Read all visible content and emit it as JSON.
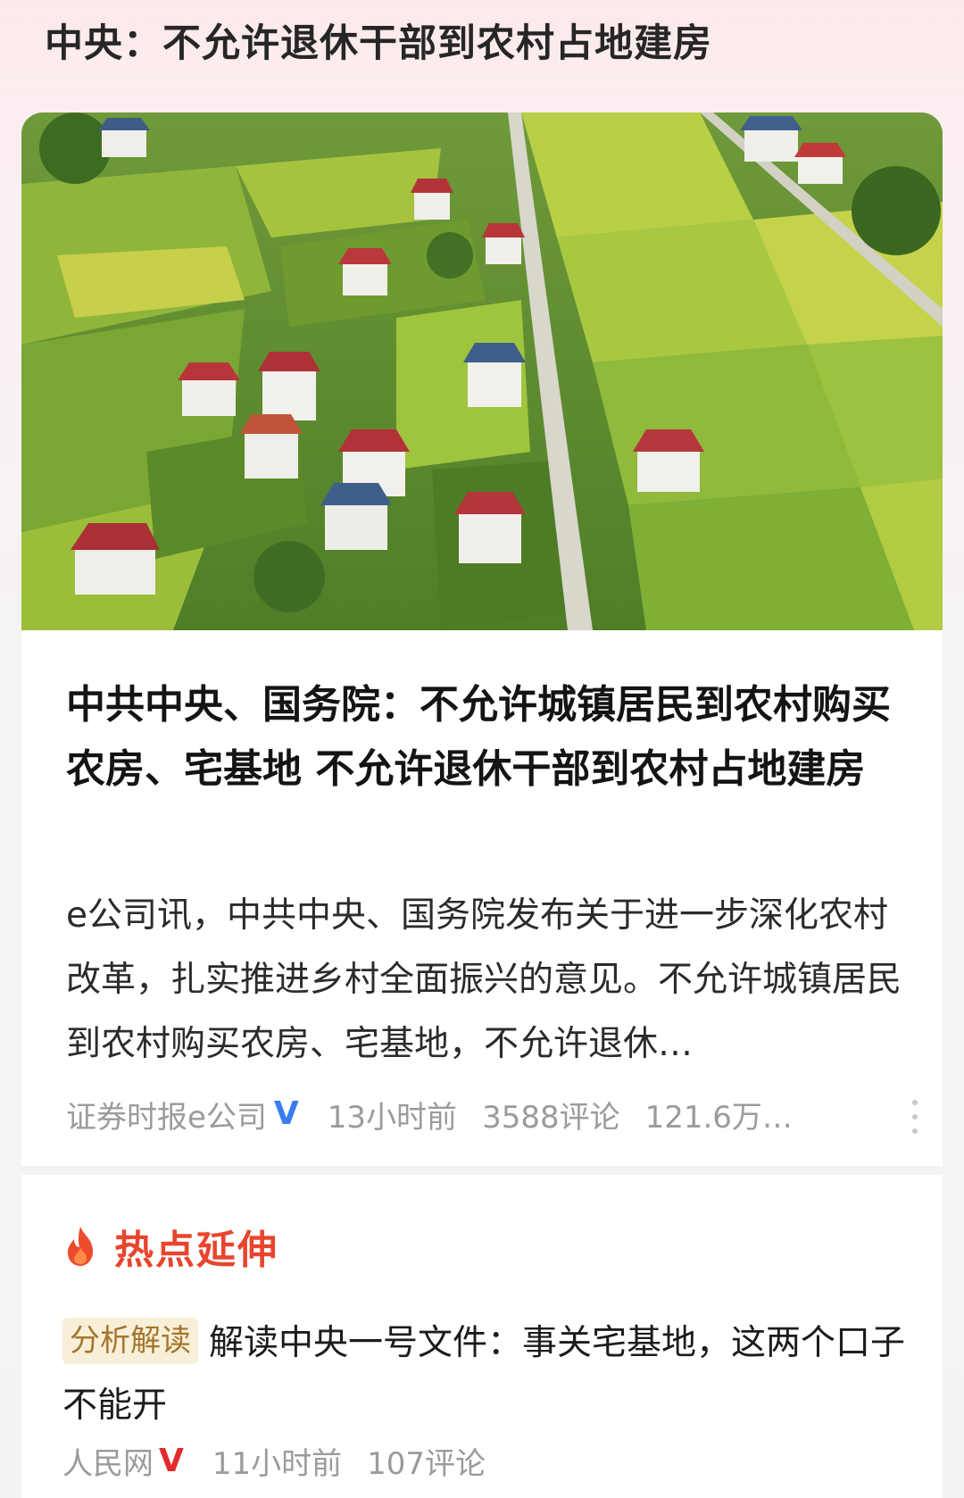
{
  "page": {
    "top_title": "中央：不允许退休干部到农村占地建房"
  },
  "article": {
    "headline": "中共中央、国务院：不允许城镇居民到农村购买农房、宅基地 不允许退休干部到农村占地建房",
    "summary": "e公司讯，中共中央、国务院发布关于进一步深化农村改革，扎实推进乡村全面振兴的意见。不允许城镇居民到农村购买农房、宅基地，不允许退休…",
    "source": "证券时报e公司",
    "verified_mark": "V",
    "time": "13小时前",
    "comments": "3588评论",
    "views": "121.6万…",
    "image_alt": "aerial-view-rural-village"
  },
  "hot_section": {
    "title": "热点延伸",
    "item": {
      "tag": "分析解读",
      "title": "解读中央一号文件：事关宅基地，这两个口子不能开",
      "source": "人民网",
      "verified_mark": "V",
      "time": "11小时前",
      "comments": "107评论"
    }
  },
  "colors": {
    "accent_red": "#e8452e",
    "verified_blue": "#3a7bf0",
    "verified_red": "#e32b2b",
    "tag_bg": "#f8efd9",
    "tag_text": "#a4762c"
  },
  "icons": {
    "more": "vertical-ellipsis-icon",
    "hot": "fire-icon",
    "verified": "verified-v-icon"
  }
}
